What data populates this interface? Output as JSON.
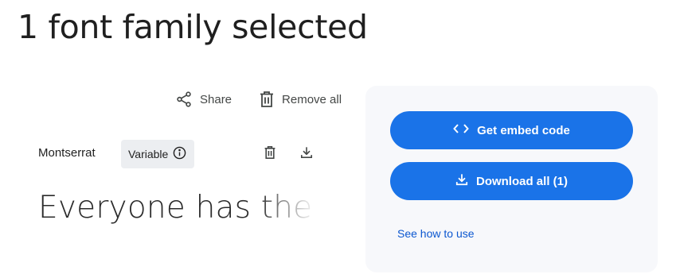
{
  "header": {
    "title": "1 font family selected"
  },
  "toolbar": {
    "share_label": "Share",
    "remove_all_label": "Remove all"
  },
  "family": {
    "name": "Montserrat",
    "variable_label": "Variable",
    "preview_text": "Everyone has the r"
  },
  "panel": {
    "embed_label": "Get embed code",
    "download_label": "Download all (1)",
    "how_to_label": "See how to use"
  },
  "icons": {
    "share": "share-icon",
    "remove_all": "trash-icon",
    "info": "info-icon",
    "remove_family": "trash-icon",
    "download_family": "download-icon",
    "embed": "code-icon",
    "download_all": "download-icon"
  },
  "colors": {
    "accent": "#1a73e8",
    "link": "#0b57d0",
    "panel_bg": "#f7f8fb",
    "chip_bg": "#eceef1"
  }
}
